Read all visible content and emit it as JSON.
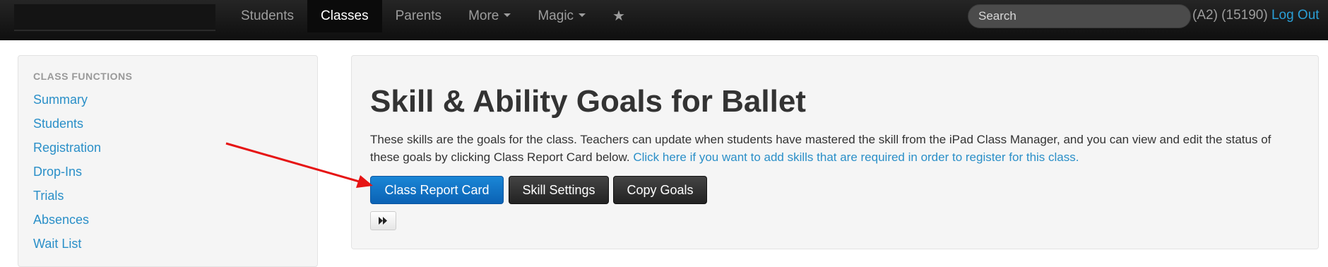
{
  "navbar": {
    "items": [
      {
        "label": "Students",
        "active": false
      },
      {
        "label": "Classes",
        "active": true
      },
      {
        "label": "Parents",
        "active": false
      },
      {
        "label": "More",
        "active": false,
        "dropdown": true
      },
      {
        "label": "Magic",
        "active": false,
        "dropdown": true
      }
    ],
    "star_icon": "star-icon",
    "search_placeholder": "Search",
    "user_info": "(A2) (15190)",
    "logout_label": "Log Out"
  },
  "sidebar": {
    "header": "CLASS FUNCTIONS",
    "links": [
      "Summary",
      "Students",
      "Registration",
      "Drop-Ins",
      "Trials",
      "Absences",
      "Wait List"
    ]
  },
  "main": {
    "title": "Skill & Ability Goals for Ballet",
    "description": "These skills are the goals for the class. Teachers can update when students have mastered the skill from the iPad Class Manager, and you can view and edit the status of these goals by clicking Class Report Card below.",
    "description_link": "Click here if you want to add skills that are required in order to register for this class.",
    "buttons": {
      "report_card": "Class Report Card",
      "skill_settings": "Skill Settings",
      "copy_goals": "Copy Goals"
    },
    "fast_forward_icon": "fast-forward-icon"
  },
  "colors": {
    "link": "#2a8fc8",
    "primary_button": "#0b62b4",
    "dark_button": "#222222",
    "annotation_arrow": "#e61414"
  }
}
